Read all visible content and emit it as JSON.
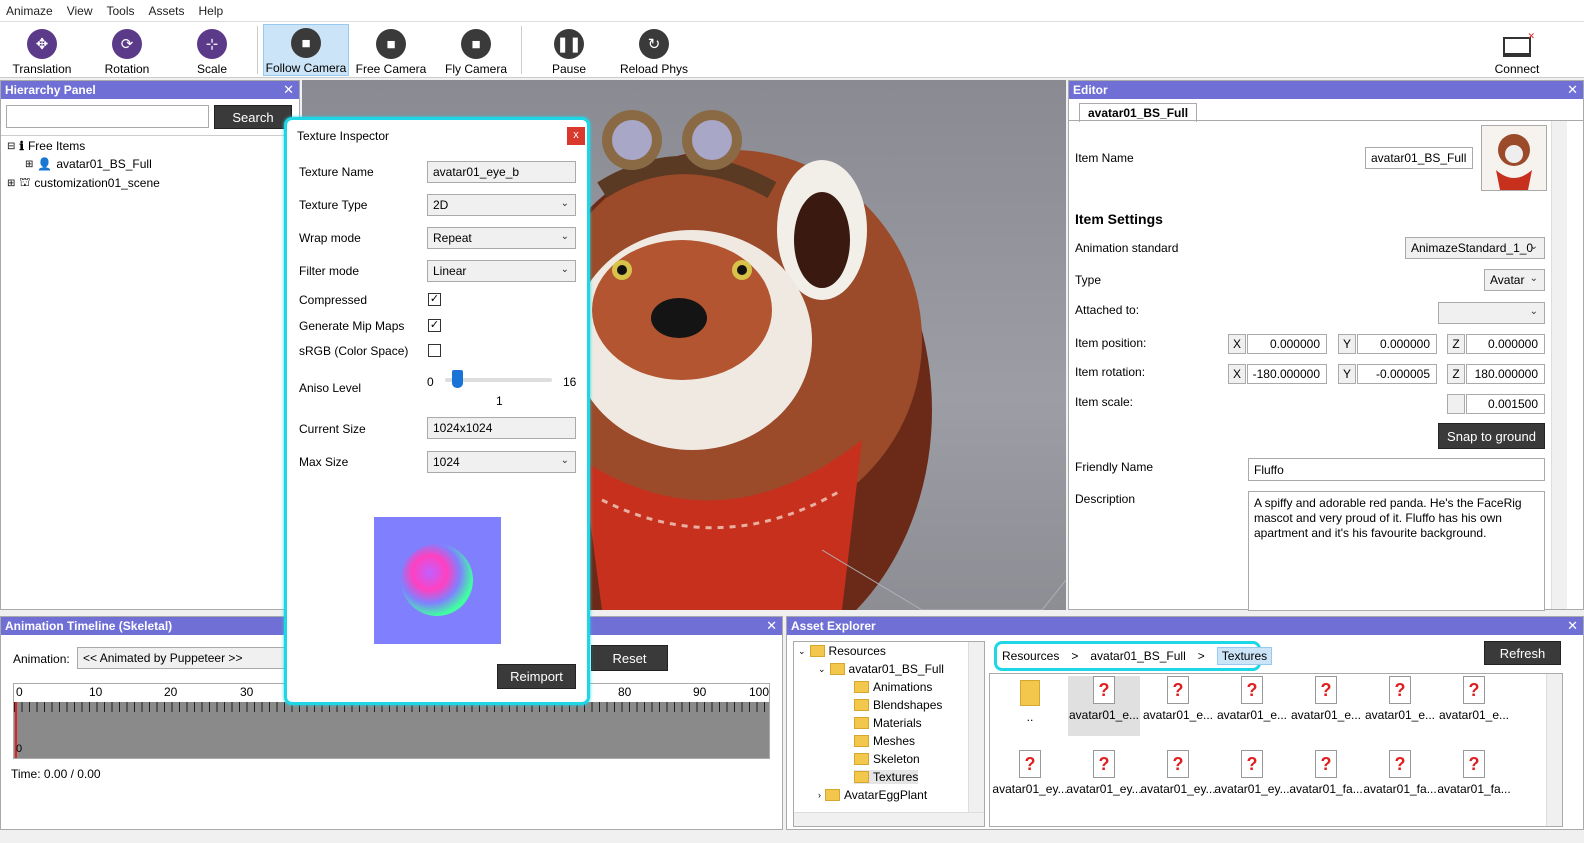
{
  "menu": [
    "Animaze",
    "View",
    "Tools",
    "Assets",
    "Help"
  ],
  "toolbar": {
    "translation": "Translation",
    "rotation": "Rotation",
    "scale": "Scale",
    "follow_camera": "Follow Camera",
    "free_camera": "Free Camera",
    "fly_camera": "Fly Camera",
    "pause": "Pause",
    "reload_phys": "Reload Phys",
    "connect": "Connect"
  },
  "hierarchy": {
    "title": "Hierarchy Panel",
    "search_label": "Search",
    "search_value": "",
    "items": [
      "Free Items",
      "avatar01_BS_Full",
      "customization01_scene"
    ]
  },
  "texture_inspector": {
    "title": "Texture Inspector",
    "close": "x",
    "texture_name_label": "Texture Name",
    "texture_name": "avatar01_eye_b",
    "texture_type_label": "Texture Type",
    "texture_type": "2D",
    "wrap_mode_label": "Wrap mode",
    "wrap_mode": "Repeat",
    "filter_mode_label": "Filter mode",
    "filter_mode": "Linear",
    "compressed_label": "Compressed",
    "compressed": true,
    "mipmaps_label": "Generate Mip Maps",
    "mipmaps": true,
    "srgb_label": "sRGB (Color Space)",
    "srgb": false,
    "aniso_label": "Aniso Level",
    "aniso_min": "0",
    "aniso_max": "16",
    "aniso_value": "1",
    "aniso_fraction": 0.0625,
    "current_size_label": "Current Size",
    "current_size": "1024x1024",
    "max_size_label": "Max Size",
    "max_size": "1024",
    "reimport": "Reimport"
  },
  "editor": {
    "title": "Editor",
    "tab": "avatar01_BS_Full",
    "item_name_label": "Item Name",
    "item_name": "avatar01_BS_Full",
    "item_settings": "Item Settings",
    "animation_standard_label": "Animation standard",
    "animation_standard": "AnimazeStandard_1_0",
    "type_label": "Type",
    "type": "Avatar",
    "attached_label": "Attached to:",
    "attached": "",
    "position_label": "Item position:",
    "position": {
      "x": "0.000000",
      "y": "0.000000",
      "z": "0.000000"
    },
    "rotation_label": "Item rotation:",
    "rotation": {
      "x": "-180.000000",
      "y": "-0.000005",
      "z": "180.000000"
    },
    "scale_label": "Item scale:",
    "scale": "0.001500",
    "snap": "Snap to ground",
    "friendly_name_label": "Friendly Name",
    "friendly_name": "Fluffo",
    "description_label": "Description",
    "description": "A spiffy and adorable red panda. He's the FaceRig mascot and very proud of it. Fluffo has his own apartment and it's his favourite background.",
    "axis": {
      "x": "X",
      "y": "Y",
      "z": "Z"
    }
  },
  "animation": {
    "title": "Animation Timeline (Skeletal)",
    "animation_label": "Animation:",
    "animation_value": "<< Animated by Puppeteer >>",
    "reset": "Reset",
    "ticks": [
      "0",
      "10",
      "20",
      "30",
      "80",
      "90",
      "100"
    ],
    "zero": "0",
    "time": "Time: 0.00 / 0.00"
  },
  "assets": {
    "title": "Asset Explorer",
    "refresh": "Refresh",
    "breadcrumb": [
      "Resources",
      ">",
      "avatar01_BS_Full",
      ">",
      "Textures"
    ],
    "tree": [
      "Resources",
      "avatar01_BS_Full",
      "Animations",
      "Blendshapes",
      "Materials",
      "Meshes",
      "Skeleton",
      "Textures",
      "AvatarEggPlant"
    ],
    "row1": [
      "..",
      "avatar01_e...",
      "avatar01_e...",
      "avatar01_e...",
      "avatar01_e...",
      "avatar01_e...",
      "avatar01_e..."
    ],
    "row2": [
      "avatar01_ey...",
      "avatar01_ey...",
      "avatar01_ey...",
      "avatar01_ey...",
      "avatar01_fa...",
      "avatar01_fa...",
      "avatar01_fa..."
    ]
  },
  "colors": {
    "panel_title": "#6f6fd6",
    "highlight": "#1fd6e6",
    "dark_button": "#3a3a3a"
  }
}
